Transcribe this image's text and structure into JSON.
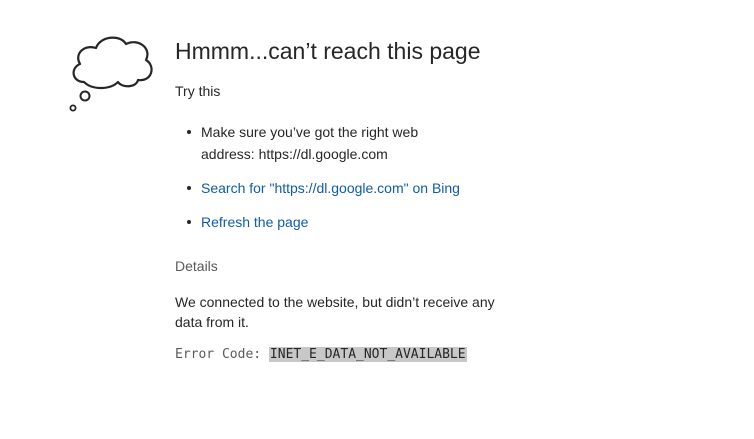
{
  "page": {
    "title": "Hmmm...can’t reach this page",
    "try_this": "Try this",
    "suggestions": [
      {
        "line1": "Make sure you’ve got the right web",
        "line2": "address: https://dl.google.com"
      },
      {
        "link": "Search for \"https://dl.google.com\" on Bing"
      },
      {
        "link": "Refresh the page"
      }
    ],
    "details_label": "Details",
    "details_text": "We connected to the website, but didn’t receive any data from it.",
    "error_code_label": "Error Code:",
    "error_code_value": "INET_E_DATA_NOT_AVAILABLE"
  },
  "icons": {
    "cloud": "thought-cloud-icon"
  },
  "colors": {
    "text": "#262626",
    "link": "#0f5ca8",
    "muted": "#5a5a5a",
    "highlight": "#c8c8c8"
  }
}
